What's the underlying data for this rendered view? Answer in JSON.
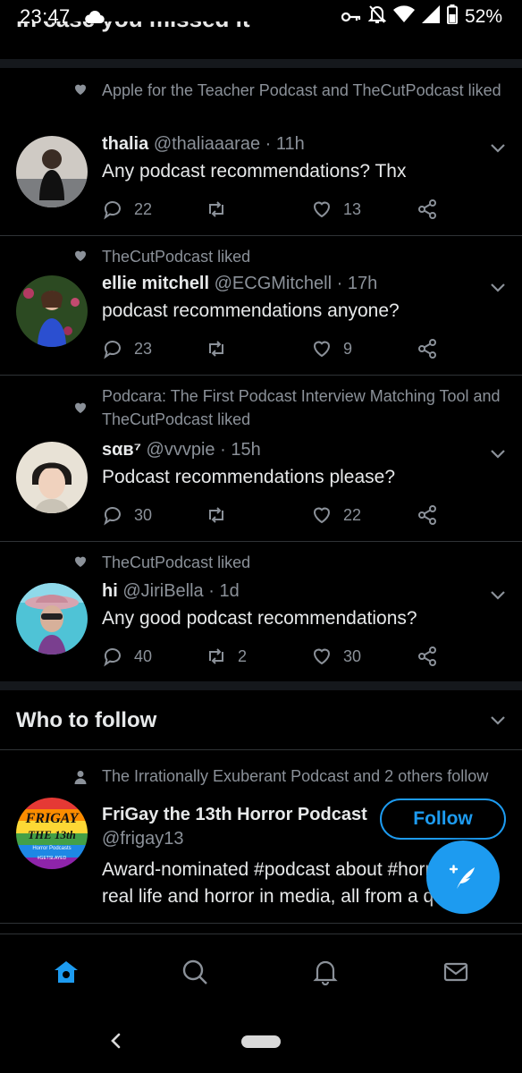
{
  "status_bar": {
    "time": "23:47",
    "battery": "52%",
    "icons": [
      "cloud-icon",
      "key-icon",
      "notifications-off-icon",
      "wifi-icon",
      "signal-icon",
      "battery-icon"
    ]
  },
  "section_header_partial": "In case you missed it",
  "tweets": [
    {
      "liked_by": "Apple for the Teacher Podcast and TheCutPodcast liked",
      "name": "thalia",
      "handle": "@thaliaaarae",
      "sep": "·",
      "age": "11h",
      "text": "Any podcast recommendations? Thx",
      "replies": "22",
      "retweets": "",
      "likes": "13"
    },
    {
      "liked_by": "TheCutPodcast liked",
      "name": "ellie mitchell",
      "handle": "@ECGMitchell",
      "sep": "·",
      "age": "17h",
      "text": "podcast recommendations anyone?",
      "replies": "23",
      "retweets": "",
      "likes": "9"
    },
    {
      "liked_by": "Podcara: The First Podcast Interview Matching Tool and TheCutPodcast liked",
      "name": "ѕαв⁷",
      "handle": "@vvvpie",
      "sep": "·",
      "age": "15h",
      "text": "Podcast recommendations please?",
      "replies": "30",
      "retweets": "",
      "likes": "22"
    },
    {
      "liked_by": "TheCutPodcast liked",
      "name": "hi",
      "handle": "@JiriBella",
      "sep": "·",
      "age": "1d",
      "text": "Any good podcast recommendations?",
      "replies": "40",
      "retweets": "2",
      "likes": "30"
    }
  ],
  "who_to_follow": {
    "title": "Who to follow",
    "followed_by": "The Irrationally Exuberant Podcast and 2 others follow",
    "name": "FriGay the 13th Horror Podcast",
    "handle": "@frigay13",
    "bio": "Award-nominated #podcast about #horror in real life and horror in media, all from a queer perspective...",
    "follow_label": "Follow",
    "avatar_text": {
      "line1": "FRIGAY",
      "line2": "THE 13th",
      "line3": "Horror Podcasts",
      "line4": "#GETSLAYED"
    }
  },
  "colors": {
    "accent": "#1d9bf0",
    "background": "#000000",
    "muted": "#8b9199"
  }
}
